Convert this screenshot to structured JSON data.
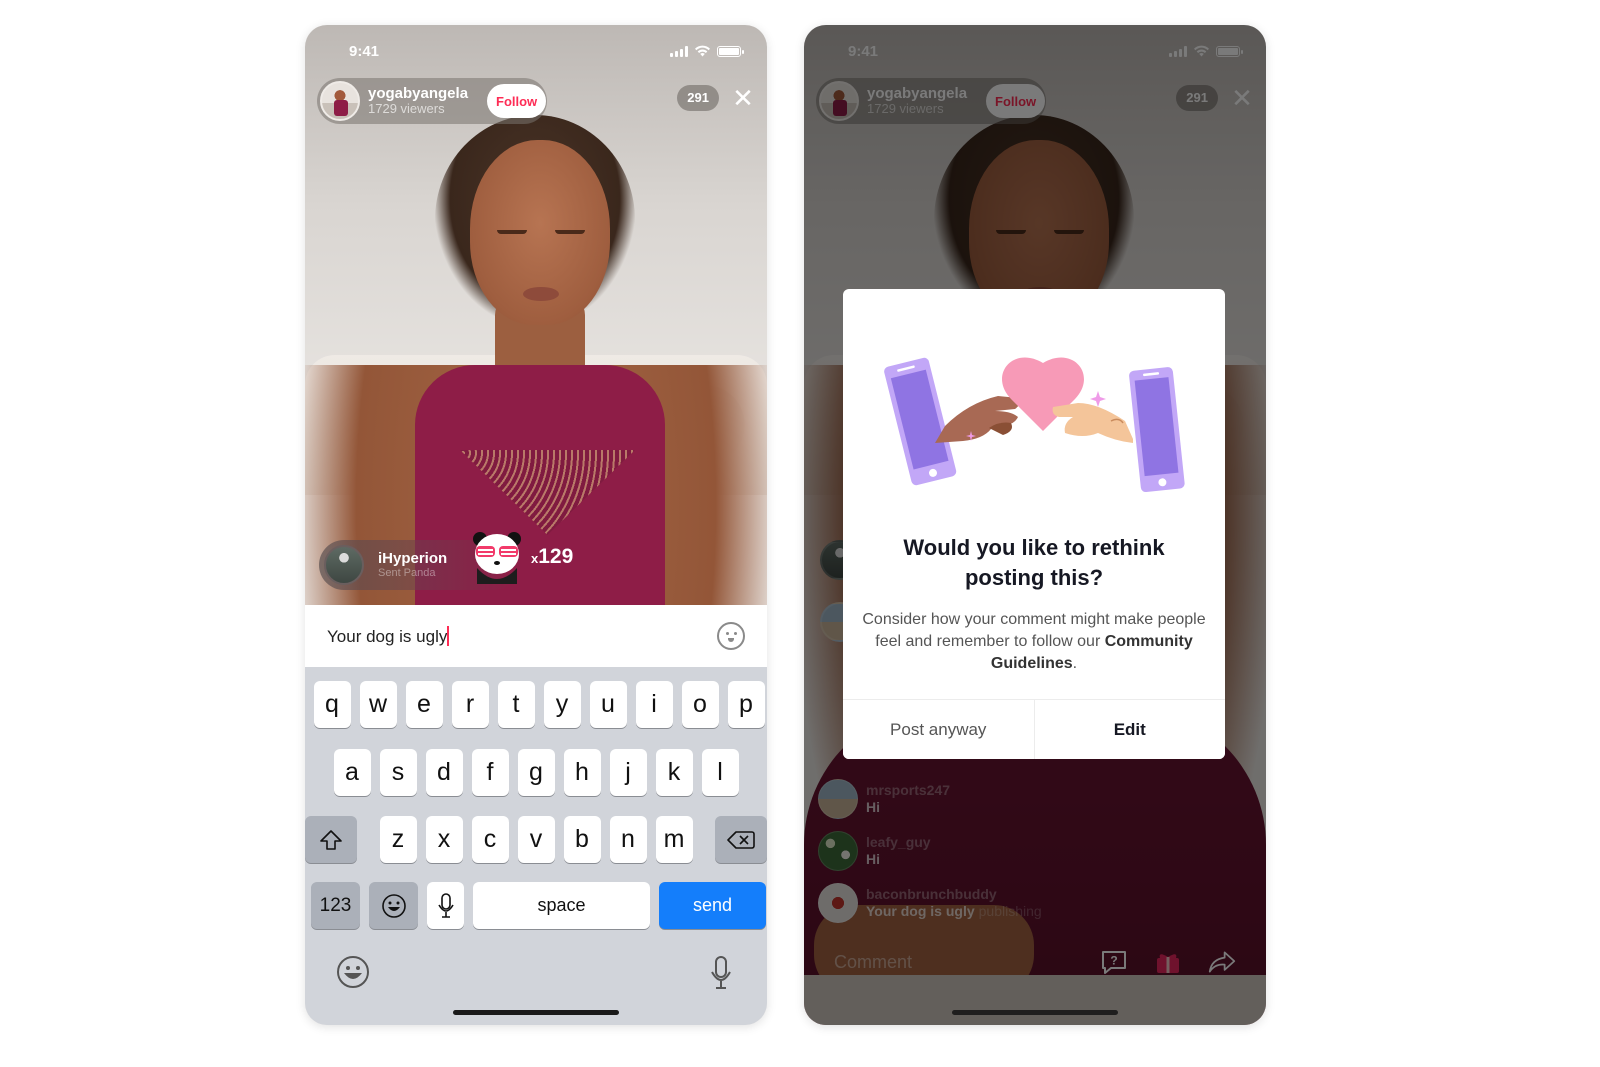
{
  "status_bar": {
    "time": "9:41"
  },
  "live": {
    "host_name": "yogabyangela",
    "viewers_label": "1729 viewers",
    "follow_label": "Follow",
    "viewer_count": "291",
    "close_icon": "close-icon"
  },
  "gift": {
    "sender": "iHyperion",
    "action": "Sent Panda",
    "count_prefix": "x",
    "count": "129",
    "gift_icon": "panda-icon"
  },
  "composer": {
    "text": "Your dog is ugly",
    "emoji_icon": "smiley-icon"
  },
  "keyboard": {
    "row1": [
      "q",
      "w",
      "e",
      "r",
      "t",
      "y",
      "u",
      "i",
      "o",
      "p"
    ],
    "row2": [
      "a",
      "s",
      "d",
      "f",
      "g",
      "h",
      "j",
      "k",
      "l"
    ],
    "row3": [
      "z",
      "x",
      "c",
      "v",
      "b",
      "n",
      "m"
    ],
    "shift_icon": "shift-icon",
    "backspace_icon": "backspace-icon",
    "numbers_label": "123",
    "space_label": "space",
    "send_label": "send",
    "colors": {
      "send": "#147efb"
    }
  },
  "modal": {
    "title": "Would you like to rethink posting this?",
    "body_prefix": "Consider how your comment might make people feel and remember to follow our ",
    "body_link": "Community Guidelines",
    "body_suffix": ".",
    "secondary_label": "Post anyway",
    "primary_label": "Edit",
    "illustration": "hands-sharing-heart-between-phones"
  },
  "comments": [
    {
      "user": "mrsports247",
      "message": "Hi",
      "status": ""
    },
    {
      "user": "leafy_guy",
      "message": "Hi",
      "status": ""
    },
    {
      "user": "baconbrunchbuddy",
      "message": "Your dog is ugly",
      "status": "publishing"
    }
  ],
  "bottom_bar": {
    "comment_placeholder": "Comment",
    "icons": [
      "question-icon",
      "gift-icon",
      "share-icon"
    ]
  },
  "colors": {
    "accent": "#fe2c55",
    "gift": "#e8265e"
  }
}
